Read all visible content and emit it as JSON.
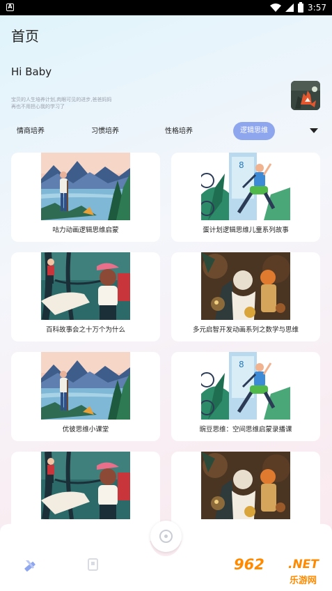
{
  "status_bar": {
    "time": "3:57",
    "left_icon": "A"
  },
  "header": {
    "title": "首页",
    "greeting": "Hi Baby",
    "description": "宝贝的人生培养计划,肉眼可见的进步,爸爸妈妈再也不用担心我的学习了"
  },
  "tabs": [
    {
      "label": "情商培养",
      "active": false
    },
    {
      "label": "习惯培养",
      "active": false
    },
    {
      "label": "性格培养",
      "active": false
    },
    {
      "label": "逻辑思维",
      "active": true
    }
  ],
  "cards": [
    {
      "title": "咕力动画逻辑思维启蒙",
      "image": "lake-hiker-illustration"
    },
    {
      "title": "蛋计划逻辑思维儿童系列故事",
      "image": "runner-door-illustration"
    },
    {
      "title": "百科故事会之十万个为什么",
      "image": "forest-boy-illustration"
    },
    {
      "title": "多元启智开发动画系列之数学与思维",
      "image": "fantasy-characters-illustration"
    },
    {
      "title": "优彼思维小课堂",
      "image": "lake-hiker-illustration"
    },
    {
      "title": "豌豆思维：空间思维启蒙录播课",
      "image": "runner-door-illustration"
    },
    {
      "title": "",
      "image": "forest-boy-illustration"
    },
    {
      "title": "",
      "image": "fantasy-characters-illustration"
    }
  ],
  "bottom_nav": {
    "items": [
      "pencil-ruler-icon",
      "book-icon",
      "play-disc-icon",
      "profile-icon"
    ]
  },
  "watermark": {
    "number": "962",
    "domain": ".NET",
    "site_name": "乐游网"
  },
  "colors": {
    "active_tab": "#8ea6ee",
    "watermark": "#ff8a00",
    "nav_active": "#8ea6ee"
  }
}
